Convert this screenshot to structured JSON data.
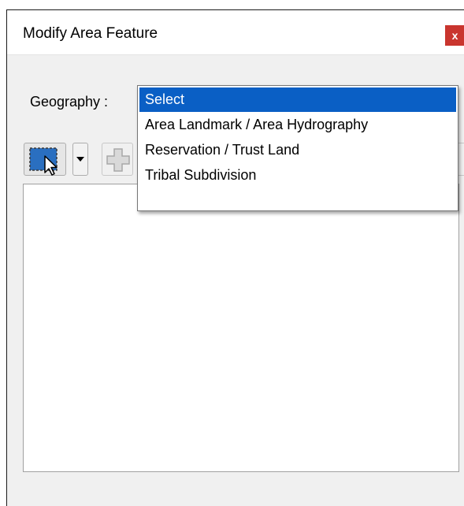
{
  "window": {
    "title": "Modify Area Feature",
    "close_label": "x"
  },
  "geography": {
    "label": "Geography :",
    "selected": "Select",
    "options": [
      "Select",
      "Area Landmark / Area Hydrography",
      "Reservation / Trust Land",
      "Tribal Subdivision"
    ]
  },
  "toolbar": {
    "select_tool_icon": "select-arrow-icon",
    "dropdown_icon": "chevron-down-icon",
    "add_icon": "plus-icon"
  },
  "colors": {
    "selection_blue": "#0a5fc5",
    "close_red": "#c9352e"
  }
}
